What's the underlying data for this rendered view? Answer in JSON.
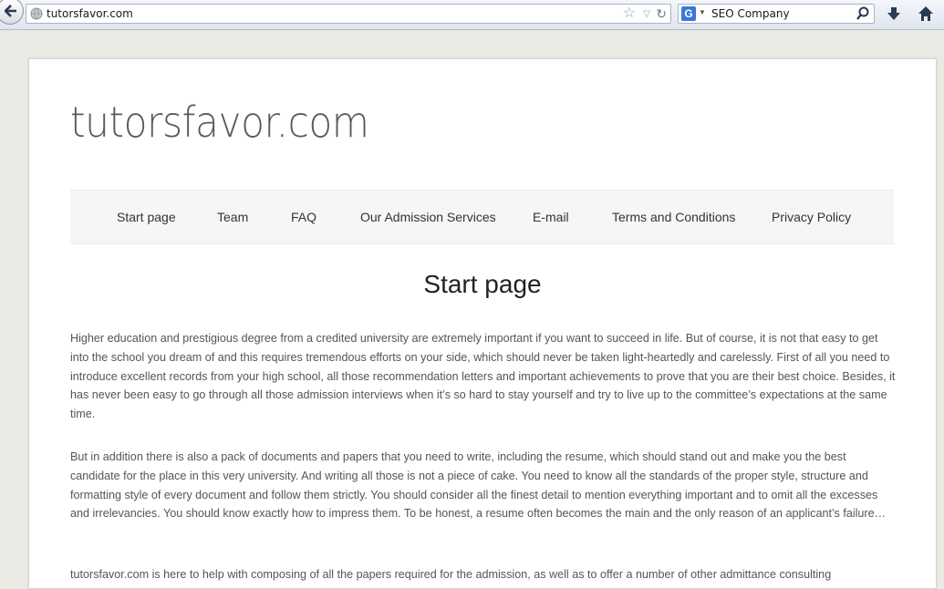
{
  "browser": {
    "url": "tutorsfavor.com",
    "search_value": "SEO Company",
    "search_engine_icon": "G"
  },
  "site": {
    "title": "tutorsfavor.com"
  },
  "nav": {
    "items": [
      {
        "label": "Start page"
      },
      {
        "label": "Team"
      },
      {
        "label": "FAQ"
      },
      {
        "label": "Our Admission Services"
      },
      {
        "label": "E-mail"
      },
      {
        "label": "Terms and Conditions"
      },
      {
        "label": "Privacy Policy"
      }
    ]
  },
  "content": {
    "heading": "Start page",
    "paragraphs": [
      "Higher education and prestigious degree from a credited university are extremely important if you want to succeed in life. But of course, it is not that easy to get into the school you dream of and this requires tremendous efforts on your side, which should never be taken light-heartedly and carelessly. First of all you need to introduce excellent records from your high school, all those recommendation letters and important achievements to prove that you are their best choice. Besides, it has never been easy to go through all those admission interviews when it’s so hard to stay yourself and try to live up to the committee’s expectations at the same time.",
      "But in addition there is also a pack of documents and papers that you need to write, including the resume, which should stand out and make you the best candidate for the place in this very university. And writing all those is not a piece of cake. You need to know all the standards of the proper style, structure and formatting style of every document and follow them strictly. You should consider all the finest detail to mention everything important and to omit all the excesses and irrelevancies. You should know exactly how to impress them. To be honest, a resume often becomes the main and the only reason of an applicant’s failure…",
      "tutorsfavor.com is here to help with composing of all the papers required for the admission, as well as to offer a number of other admittance consulting"
    ]
  }
}
